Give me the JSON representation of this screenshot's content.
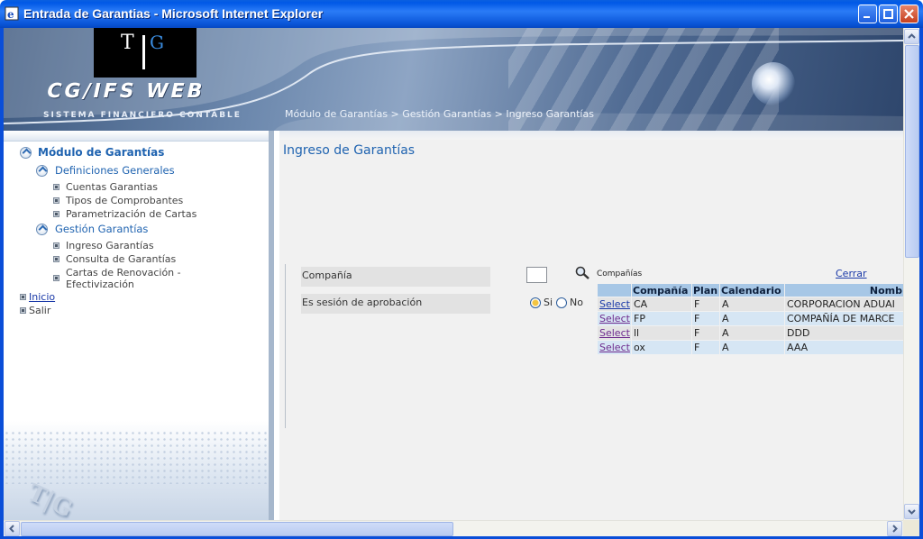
{
  "window": {
    "title": "Entrada de Garantias - Microsoft Internet Explorer"
  },
  "banner": {
    "logo_left": "T",
    "logo_right": "G",
    "brand": "CG/IFS WEB",
    "tagline": "SISTEMA FINANCIERO CONTABLE",
    "breadcrumb": "Módulo de Garantías > Gestión Garantías > Ingreso Garantías"
  },
  "sidebar": {
    "module_title": "Módulo de Garantías",
    "sections": [
      {
        "label": "Definiciones Generales",
        "items": [
          "Cuentas Garantias",
          "Tipos de Comprobantes",
          "Parametrización de Cartas"
        ]
      },
      {
        "label": "Gestión Garantías",
        "items": [
          "Ingreso Garantías",
          "Consulta de Garantías",
          "Cartas de Renovación -",
          "Efectivización"
        ]
      }
    ],
    "inicio": "Inicio",
    "salir": "Salir"
  },
  "main": {
    "page_title": "Ingreso de Garantías",
    "fields": {
      "compania_label": "Compañía",
      "compania_value": "",
      "aprobacion_label": "Es sesión de aprobación",
      "radio_si": "Si",
      "radio_no": "No",
      "selected": "Si"
    },
    "popup": {
      "title": "Compañías",
      "close": "Cerrar",
      "columns": [
        "",
        "Compañía",
        "Plan",
        "Calendario",
        "Nomb"
      ],
      "rows": [
        [
          "Select",
          "CA",
          "F",
          "A",
          "CORPORACION ADUAI"
        ],
        [
          "Select",
          "FP",
          "F",
          "A",
          "COMPAÑÍA DE MARCE"
        ],
        [
          "Select",
          "ll",
          "F",
          "A",
          "DDD"
        ],
        [
          "Select",
          "ox",
          "F",
          "A",
          "AAA"
        ]
      ]
    }
  },
  "colors": {
    "titlebar": "#0a5fe0",
    "accent_text": "#1f63b0",
    "grid_header": "#a7c7e6"
  }
}
